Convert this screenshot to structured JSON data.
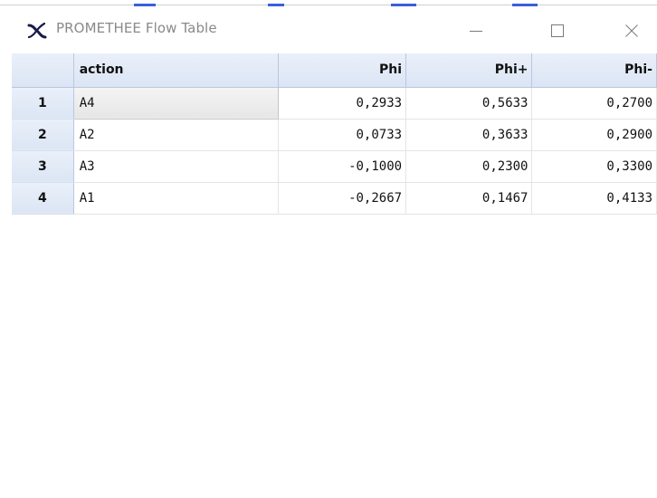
{
  "window": {
    "title": "PROMETHEE Flow Table",
    "icon": "promethee-x-icon",
    "controls": {
      "minimize_glyph": "—",
      "maximize_glyph": "☐",
      "close_glyph": "✕"
    }
  },
  "table": {
    "columns": [
      "",
      "action",
      "Phi",
      "Phi+",
      "Phi-"
    ],
    "rows": [
      {
        "index": "1",
        "action": "A4",
        "phi": "0,2933",
        "phi_plus": "0,5633",
        "phi_minus": "0,2700"
      },
      {
        "index": "2",
        "action": "A2",
        "phi": "0,0733",
        "phi_plus": "0,3633",
        "phi_minus": "0,2900"
      },
      {
        "index": "3",
        "action": "A3",
        "phi": "-0,1000",
        "phi_plus": "0,2300",
        "phi_minus": "0,3300"
      },
      {
        "index": "4",
        "action": "A1",
        "phi": "-0,2667",
        "phi_plus": "0,1467",
        "phi_minus": "0,4133"
      }
    ]
  },
  "colors": {
    "header_bg": "#dbe5f4",
    "accent": "#3c5fd8",
    "title_text": "#8a8a8a"
  }
}
